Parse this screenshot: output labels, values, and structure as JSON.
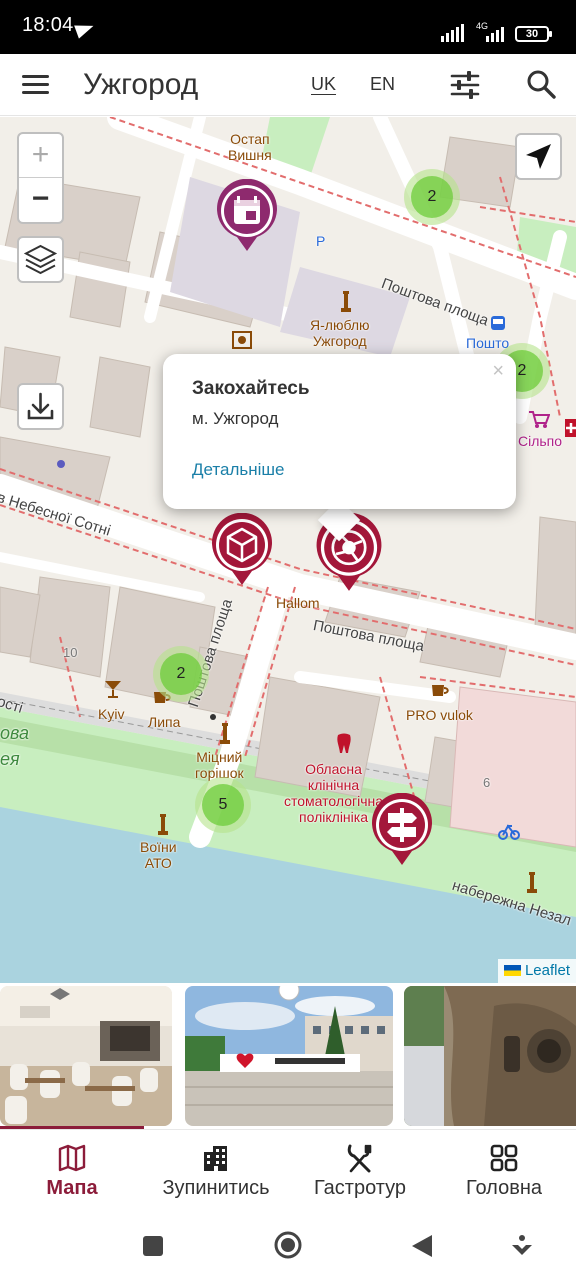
{
  "status_bar": {
    "time": "18:04",
    "network": "4G",
    "battery": "30"
  },
  "app_bar": {
    "title": "Ужгород",
    "lang_uk": "UK",
    "lang_en": "EN"
  },
  "map": {
    "zoom_in": "+",
    "zoom_out": "−",
    "street_labels": {
      "poshtova_top": "Поштова площа",
      "poshtova_middle": "Поштова площа",
      "poshtova_vertical": "Поштова площа",
      "nebesnoi_sotni": "в Небесної Сотні",
      "naberezhna": "набережна Незал",
      "osti": "ості",
      "ova": "ова",
      "eya": "ея"
    },
    "poi_labels": {
      "ostap_vyshnia": "Остап\nВишня",
      "ya_lyublyu": "Я-люблю\nУжгород",
      "poshtova": "Пошто",
      "silpo": "Сільпо",
      "hallom": "Hallom",
      "kyiv": "Kyiv",
      "lypa": "Липа",
      "pro_vulok": "PRO vulok",
      "mitsnyi": "Міцний\nгорішок",
      "klinika": "Обласна\nклінічна\nстоматологічна\nполіклініка",
      "voiny_ato": "Воїни\nАТО",
      "parking": "P",
      "house_10": "10",
      "house_6": "6"
    },
    "clusters": [
      {
        "count": "2"
      },
      {
        "count": "2"
      },
      {
        "count": "2"
      },
      {
        "count": "5"
      }
    ],
    "markers": [
      {
        "icon": "calendar-icon",
        "color": "#8e2a6e"
      },
      {
        "icon": "cube-icon",
        "color": "#a3173a"
      },
      {
        "icon": "camera-shutter-icon",
        "color": "#a3173a"
      },
      {
        "icon": "signpost-icon",
        "color": "#a3173a"
      }
    ],
    "popup": {
      "close": "×",
      "title": "Закохайтесь",
      "subtitle": "м. Ужгород",
      "link": "Детальніше"
    },
    "attribution": "Leaflet"
  },
  "strip": {
    "accent_color": "#8c1c3a"
  },
  "bottom_nav": {
    "items": [
      {
        "label": "Мапа",
        "icon": "map-icon",
        "active": true
      },
      {
        "label": "Зупинитись",
        "icon": "building-icon",
        "active": false
      },
      {
        "label": "Гастротур",
        "icon": "fork-knife-icon",
        "active": false
      },
      {
        "label": "Головна",
        "icon": "grid-icon",
        "active": false
      }
    ]
  }
}
